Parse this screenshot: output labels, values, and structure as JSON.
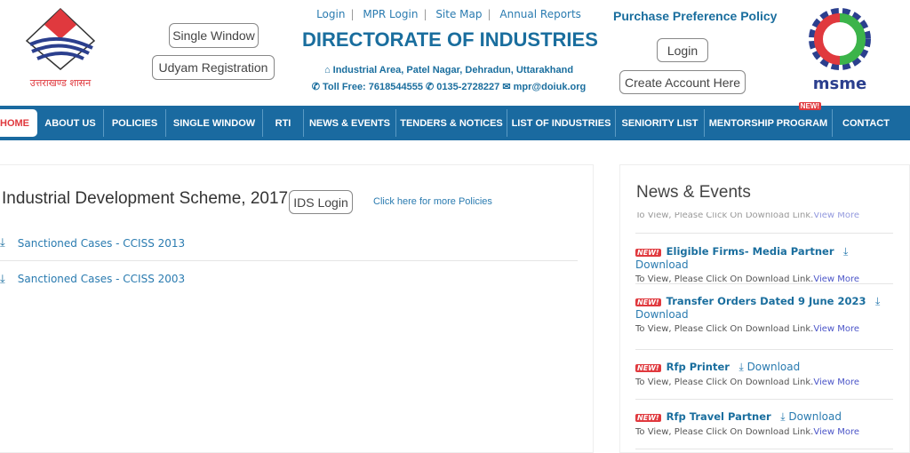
{
  "header": {
    "gov_logo_text": "उत्तराखण्ड शासन",
    "single_window": "Single Window",
    "udyam": "Udyam Registration",
    "top_links": [
      "Login",
      "MPR Login",
      "Site Map",
      "Annual Reports"
    ],
    "title": "DIRECTORATE OF INDUSTRIES",
    "address": "Industrial Area, Patel Nagar, Dehradun, Uttarakhand",
    "toll_free": "Toll Free: 7618544555",
    "phone": "0135-2728227",
    "email": "mpr@doiuk.org",
    "purchase_policy": "Purchase Preference Policy",
    "login": "Login",
    "create_account": "Create Account Here",
    "msme_logo_text": "msme"
  },
  "nav": {
    "items": [
      "HOME",
      "ABOUT US",
      "POLICIES",
      "SINGLE WINDOW",
      "RTI",
      "NEWS & EVENTS",
      "TENDERS & NOTICES",
      "LIST OF INDUSTRIES",
      "SENIORITY LIST",
      "MENTORSHIP PROGRAM",
      "CONTACT"
    ],
    "new_badge": "NEW!"
  },
  "main": {
    "title": "Industrial Development Scheme, 2017 (IDS)",
    "ids_login": "IDS Login",
    "more_policies": "Click here for more Policies",
    "cases": [
      "Sanctioned Cases - CCISS 2013",
      "Sanctioned Cases - CCISS 2003"
    ]
  },
  "news": {
    "title": "News & Events",
    "badge": "NEW!",
    "download": "Download",
    "sub": "To View, Please Click On Download Link.",
    "view_more": "View More",
    "items": [
      "Eligible Firms- Media Partner",
      "Transfer Orders Dated 9 June 2023",
      "Rfp Printer",
      "Rfp Travel Partner"
    ]
  },
  "colors": {
    "brand": "#1a6aa0",
    "accent": "#e0393e"
  }
}
